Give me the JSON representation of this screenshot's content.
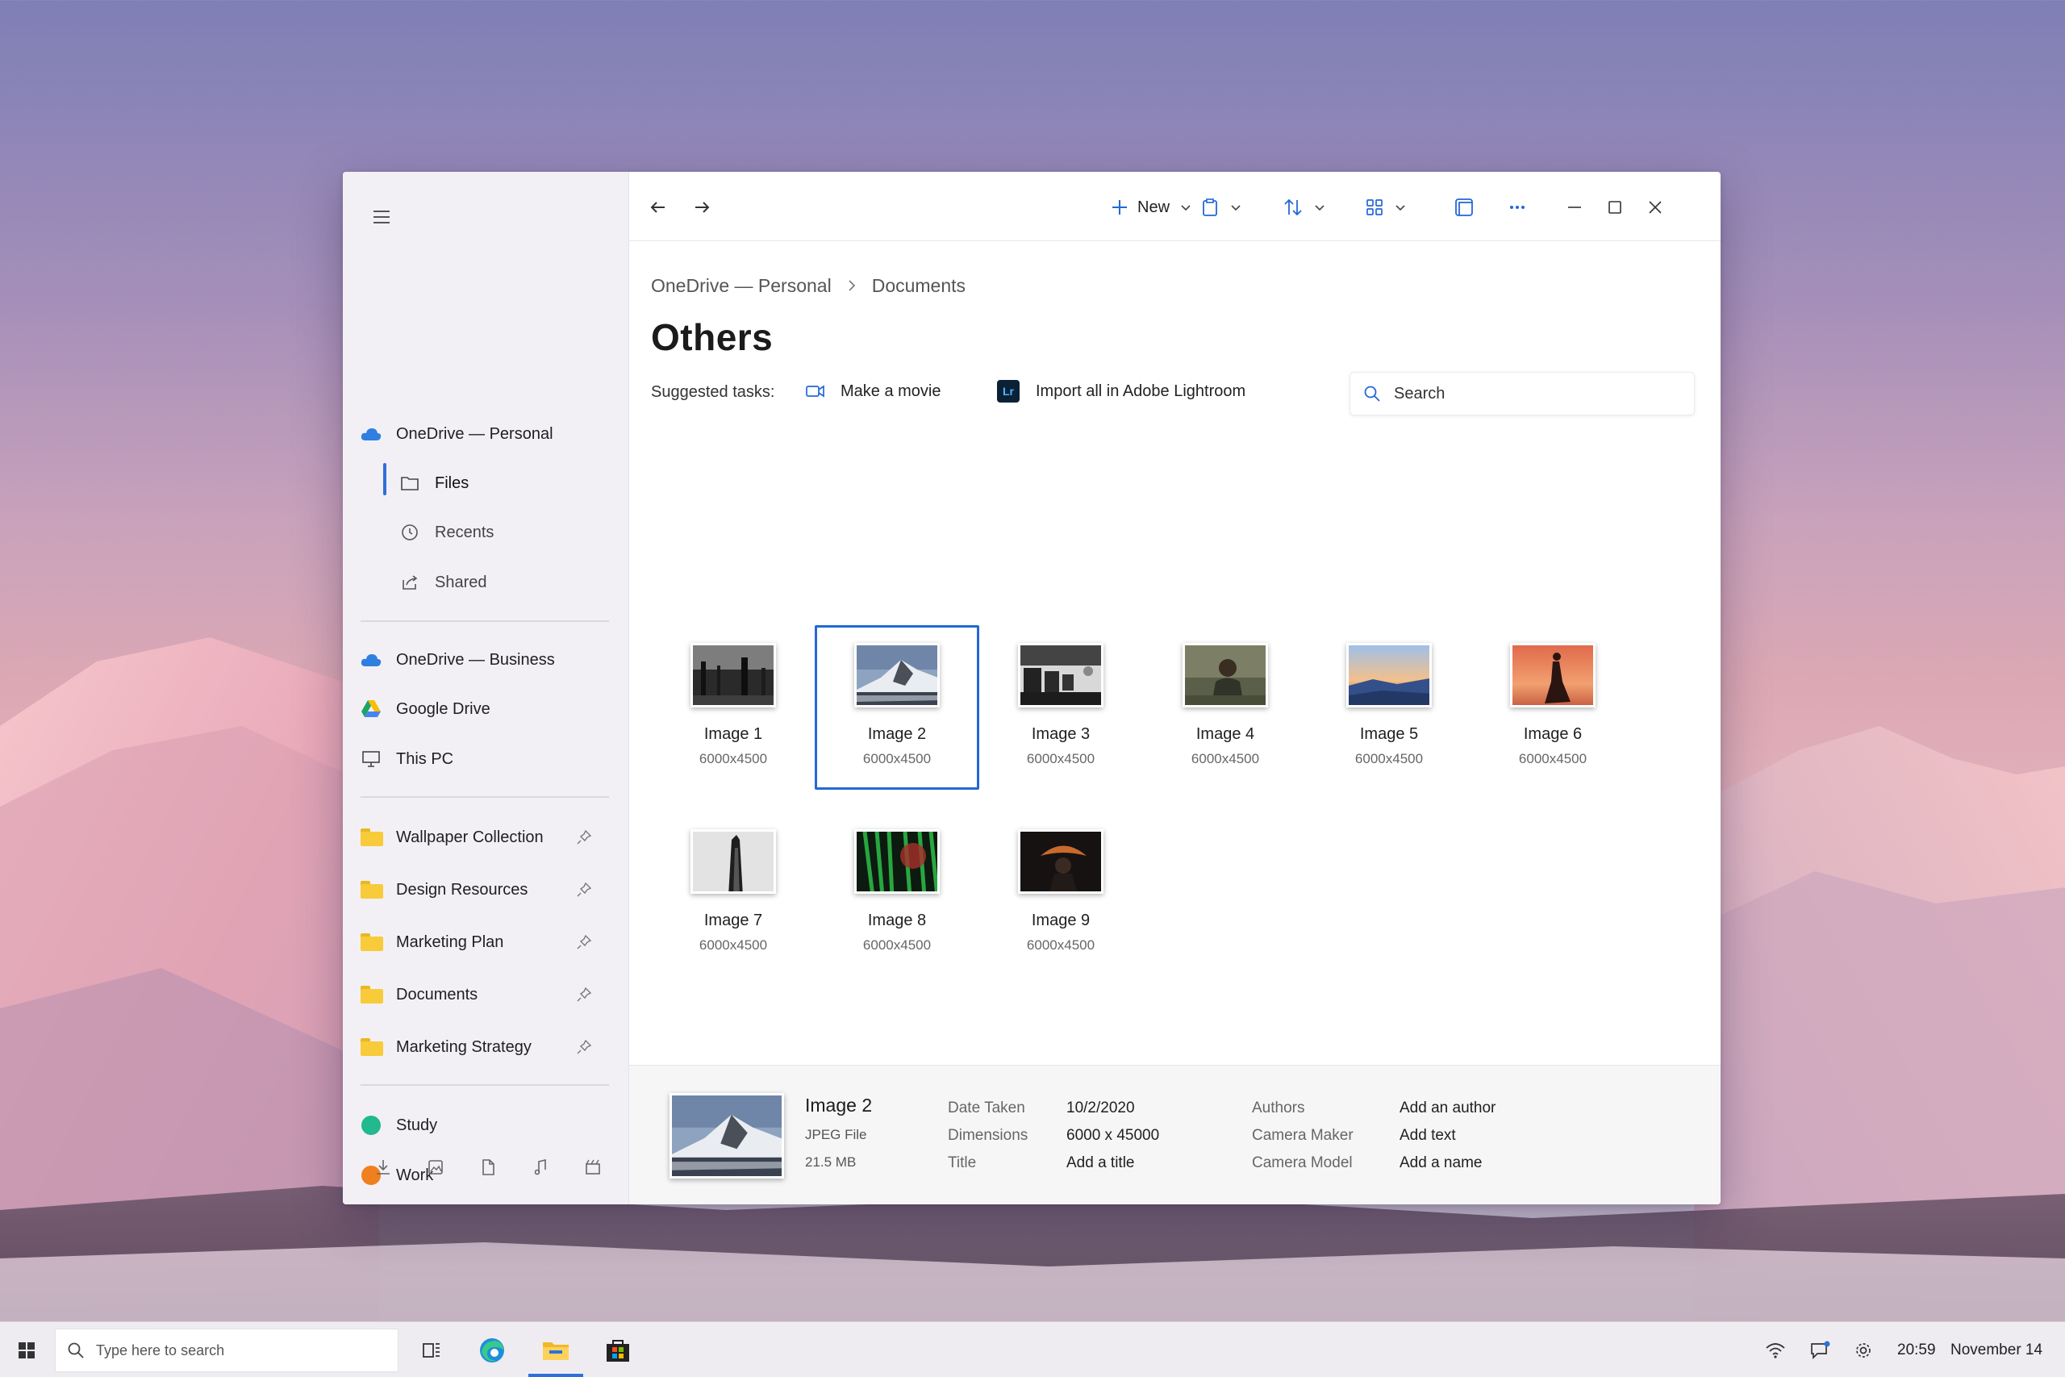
{
  "sidebar": {
    "onedrive_personal": "OneDrive — Personal",
    "sub_items": [
      {
        "label": "Files",
        "icon": "folder-outline-icon"
      },
      {
        "label": "Recents",
        "icon": "clock-icon"
      },
      {
        "label": "Shared",
        "icon": "share-icon"
      }
    ],
    "locations": [
      {
        "label": "OneDrive — Business",
        "icon": "cloud-icon"
      },
      {
        "label": "Google Drive",
        "icon": "google-drive-icon"
      },
      {
        "label": "This PC",
        "icon": "monitor-icon"
      }
    ],
    "pinned": [
      {
        "label": "Wallpaper Collection"
      },
      {
        "label": "Design Resources"
      },
      {
        "label": "Marketing Plan"
      },
      {
        "label": "Documents"
      },
      {
        "label": "Marketing Strategy"
      }
    ],
    "tags": [
      {
        "label": "Study",
        "color": "#21b98d"
      },
      {
        "label": "Work",
        "color": "#f07f1f"
      }
    ],
    "bottom_icons": [
      "download-icon",
      "picture-icon",
      "document-icon",
      "music-icon",
      "video-icon"
    ]
  },
  "toolbar": {
    "new_label": "New"
  },
  "breadcrumb": [
    "OneDrive — Personal",
    "Documents"
  ],
  "page_title": "Others",
  "suggested": {
    "label": "Suggested tasks:",
    "make_movie": "Make a movie",
    "lightroom_badge": "Lr",
    "import_lightroom": "Import all in Adobe Lightroom"
  },
  "search": {
    "placeholder": "Search"
  },
  "files": [
    {
      "name": "Image 1",
      "dims": "6000x4500"
    },
    {
      "name": "Image 2",
      "dims": "6000x4500",
      "selected": true
    },
    {
      "name": "Image 3",
      "dims": "6000x4500"
    },
    {
      "name": "Image 4",
      "dims": "6000x4500"
    },
    {
      "name": "Image 5",
      "dims": "6000x4500"
    },
    {
      "name": "Image 6",
      "dims": "6000x4500"
    },
    {
      "name": "Image 7",
      "dims": "6000x4500"
    },
    {
      "name": "Image 8",
      "dims": "6000x4500"
    },
    {
      "name": "Image 9",
      "dims": "6000x4500"
    }
  ],
  "details": {
    "name": "Image 2",
    "type": "JPEG File",
    "size": "21.5 MB",
    "fields_left": [
      {
        "label": "Date Taken",
        "value": "10/2/2020"
      },
      {
        "label": "Dimensions",
        "value": "6000 x 45000"
      },
      {
        "label": "Title",
        "value": "Add a title"
      }
    ],
    "fields_right": [
      {
        "label": "Authors",
        "value": "Add an author"
      },
      {
        "label": "Camera Maker",
        "value": "Add text"
      },
      {
        "label": "Camera Model",
        "value": "Add a name"
      }
    ]
  },
  "taskbar": {
    "search_placeholder": "Type here to search",
    "time": "20:59",
    "date": "November 14"
  },
  "colors": {
    "accent": "#2368d6",
    "onedrive": "#2f7fe0"
  }
}
